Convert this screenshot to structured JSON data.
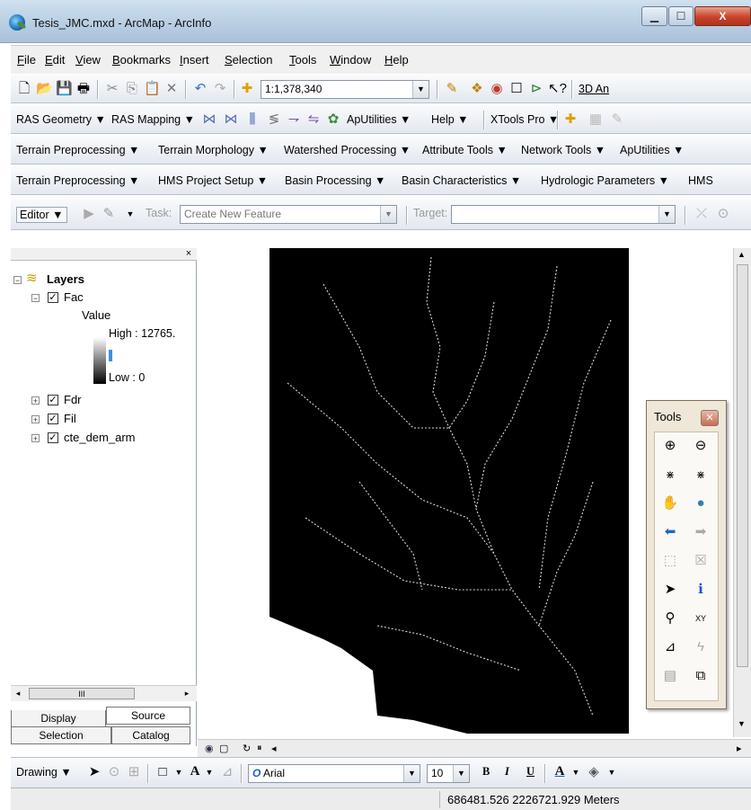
{
  "window": {
    "title": "Tesis_JMC.mxd - ArcMap - ArcInfo",
    "min_label": "▁",
    "max_label": "☐",
    "close_label": "X"
  },
  "menu": [
    "File",
    "Edit",
    "View",
    "Bookmarks",
    "Insert",
    "Selection",
    "Tools",
    "Window",
    "Help"
  ],
  "standard_toolbar": {
    "scale": "1:1,378,340",
    "analyst_label": "3D An"
  },
  "ras_toolbar": {
    "geometry": "RAS Geometry ▼",
    "mapping": "RAS Mapping ▼",
    "aputilities": "ApUtilities ▼",
    "help": "Help ▼",
    "xtools": "XTools Pro ▼"
  },
  "archydro_toolbar": {
    "items": [
      "Terrain Preprocessing ▼",
      "Terrain Morphology ▼",
      "Watershed Processing ▼",
      "Attribute Tools ▼",
      "Network Tools ▼",
      "ApUtilities ▼"
    ]
  },
  "hms_toolbar": {
    "items": [
      "Terrain Preprocessing ▼",
      "HMS Project Setup ▼",
      "Basin Processing ▼",
      "Basin Characteristics ▼",
      "Hydrologic Parameters ▼",
      "HMS"
    ]
  },
  "editor_toolbar": {
    "editor": "Editor ▼",
    "task_label": "Task:",
    "task_value": "Create New Feature",
    "target_label": "Target:",
    "target_value": ""
  },
  "toc": {
    "root": "Layers",
    "layers": [
      {
        "name": "Fac",
        "expanded": true,
        "checked": true
      },
      {
        "name": "Fdr",
        "expanded": false,
        "checked": true
      },
      {
        "name": "Fil",
        "expanded": false,
        "checked": true
      },
      {
        "name": "cte_dem_arm",
        "expanded": false,
        "checked": true
      }
    ],
    "legend_title": "Value",
    "legend_high": "High : 12765.",
    "legend_low": "Low : 0",
    "scroll_label": "III",
    "tabs": [
      "Display",
      "Source",
      "Selection",
      "Catalog"
    ]
  },
  "tools_panel": {
    "title": "Tools",
    "close": "✕",
    "tools": [
      "zoom-in",
      "zoom-out",
      "fixed-zoom-in",
      "fixed-zoom-out",
      "pan",
      "full-extent",
      "back",
      "forward",
      "select-features",
      "clear-selection",
      "select-elements",
      "identify",
      "find",
      "go-to-xy",
      "measure",
      "hyperlink",
      "html-popup",
      "time-slider"
    ]
  },
  "drawing_toolbar": {
    "drawing": "Drawing ▼",
    "font": "Arial",
    "size": "10",
    "bold": "B",
    "italic": "I",
    "underline": "U"
  },
  "status": {
    "coords": "686481.526  2226721.929 Meters"
  },
  "colors": {
    "map_background": "#000000",
    "stream_color": "#ffffff",
    "legend_low": "#000000",
    "legend_high": "#ffffff",
    "selection_blue": "#3b8fe5"
  }
}
